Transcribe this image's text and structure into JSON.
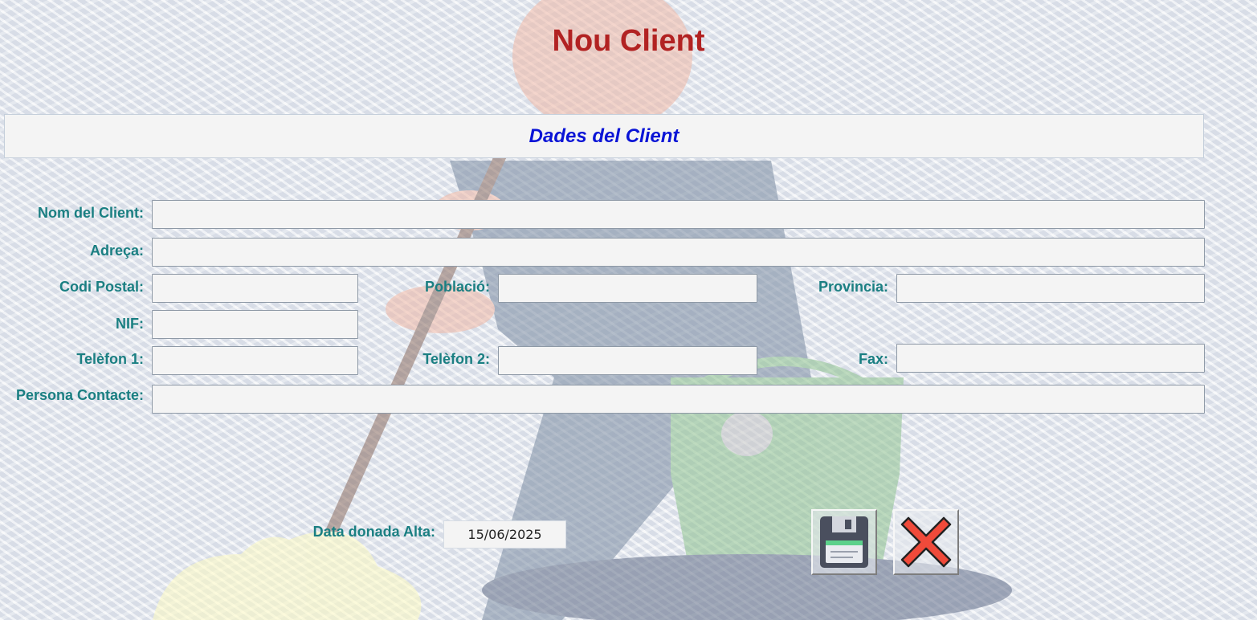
{
  "title": "Nou Client",
  "section_title": "Dades del Client",
  "labels": {
    "nom": "Nom del Client:",
    "adreca": "Adreça:",
    "codi_postal": "Codi Postal:",
    "poblacio": "Població:",
    "provincia": "Provincia:",
    "nif": "NIF:",
    "telefon1": "Telèfon 1:",
    "telefon2": "Telèfon 2:",
    "fax": "Fax:",
    "persona_contacte": "Persona Contacte:",
    "data_alta": "Data donada Alta:"
  },
  "values": {
    "nom": "",
    "adreca": "",
    "codi_postal": "",
    "poblacio": "",
    "provincia": "",
    "nif": "",
    "telefon1": "",
    "telefon2": "",
    "fax": "",
    "persona_contacte": "",
    "data_alta": "15/06/2025"
  },
  "buttons": {
    "save_icon": "floppy-disk-icon",
    "cancel_icon": "red-x-icon"
  },
  "colors": {
    "title": "#b22222",
    "section_title": "#0a14d6",
    "label": "#1a7f82"
  }
}
